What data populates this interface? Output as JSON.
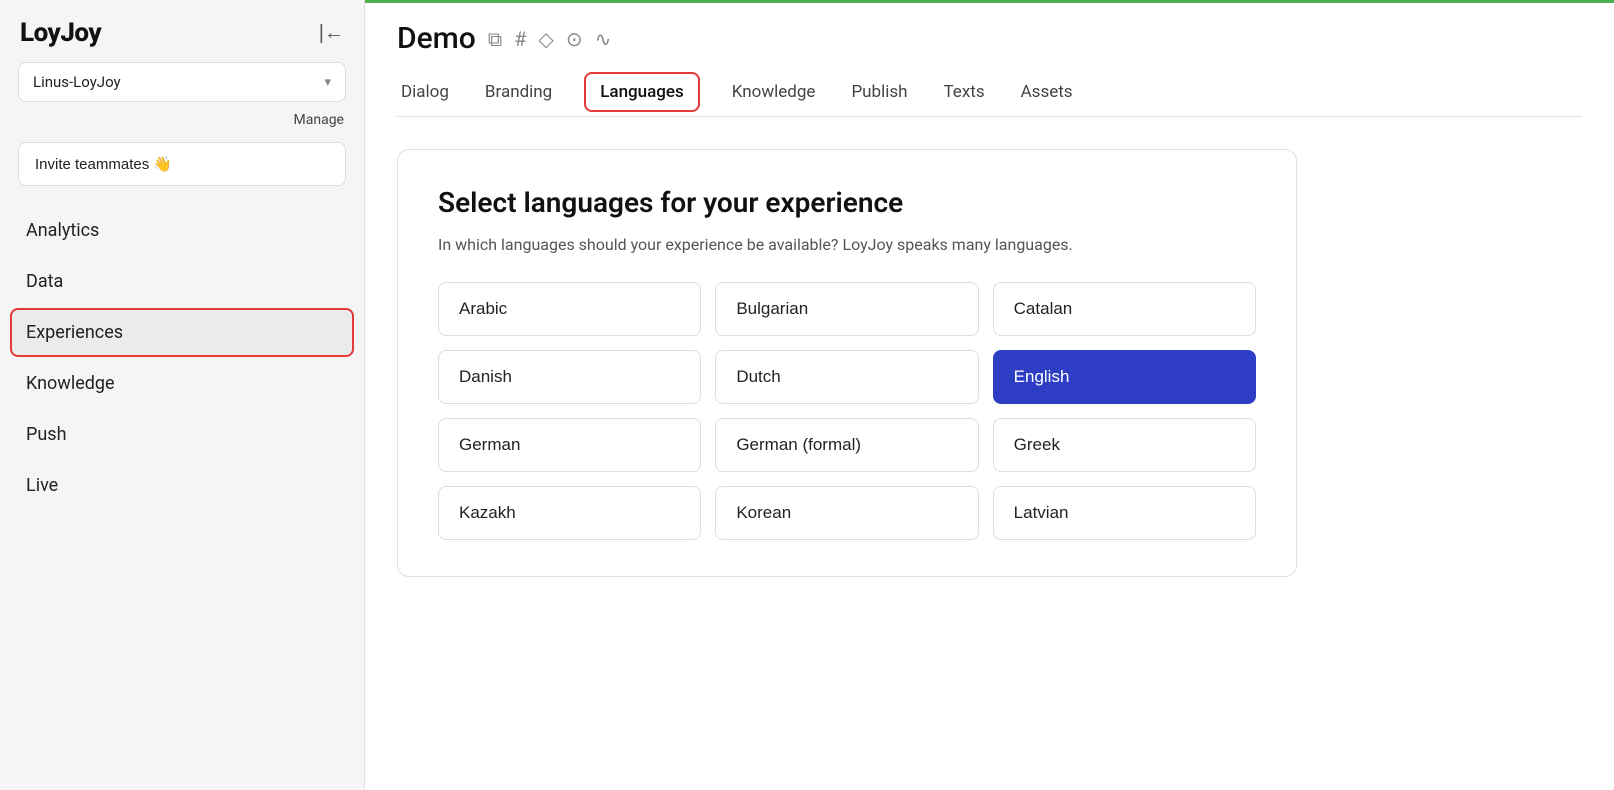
{
  "sidebar": {
    "logo": "LoyJoy",
    "collapse_icon": "⊣",
    "workspace": {
      "name": "Linus-LoyJoy",
      "chevron": "▾"
    },
    "manage_label": "Manage",
    "invite_label": "Invite teammates 👋",
    "nav_items": [
      {
        "id": "analytics",
        "label": "Analytics",
        "active": false
      },
      {
        "id": "data",
        "label": "Data",
        "active": false
      },
      {
        "id": "experiences",
        "label": "Experiences",
        "active": true
      },
      {
        "id": "knowledge",
        "label": "Knowledge",
        "active": false
      },
      {
        "id": "push",
        "label": "Push",
        "active": false
      },
      {
        "id": "live",
        "label": "Live",
        "active": false
      }
    ]
  },
  "header": {
    "project_title": "Demo",
    "icons": [
      "⧉",
      "#",
      "◇",
      "⊙",
      "∿"
    ],
    "tabs": [
      {
        "id": "dialog",
        "label": "Dialog",
        "active": false
      },
      {
        "id": "branding",
        "label": "Branding",
        "active": false
      },
      {
        "id": "languages",
        "label": "Languages",
        "active": true
      },
      {
        "id": "knowledge",
        "label": "Knowledge",
        "active": false
      },
      {
        "id": "publish",
        "label": "Publish",
        "active": false
      },
      {
        "id": "texts",
        "label": "Texts",
        "active": false
      },
      {
        "id": "assets",
        "label": "Assets",
        "active": false
      }
    ]
  },
  "languages_page": {
    "title": "Select languages for your experience",
    "subtitle": "In which languages should your experience be available? LoyJoy speaks many languages.",
    "languages": [
      {
        "id": "arabic",
        "label": "Arabic",
        "selected": false
      },
      {
        "id": "bulgarian",
        "label": "Bulgarian",
        "selected": false
      },
      {
        "id": "catalan",
        "label": "Catalan",
        "selected": false
      },
      {
        "id": "danish",
        "label": "Danish",
        "selected": false
      },
      {
        "id": "dutch",
        "label": "Dutch",
        "selected": false
      },
      {
        "id": "english",
        "label": "English",
        "selected": true
      },
      {
        "id": "german",
        "label": "German",
        "selected": false
      },
      {
        "id": "german-formal",
        "label": "German (formal)",
        "selected": false
      },
      {
        "id": "greek",
        "label": "Greek",
        "selected": false
      },
      {
        "id": "kazakh",
        "label": "Kazakh",
        "selected": false
      },
      {
        "id": "korean",
        "label": "Korean",
        "selected": false
      },
      {
        "id": "latvian",
        "label": "Latvian",
        "selected": false
      }
    ]
  }
}
